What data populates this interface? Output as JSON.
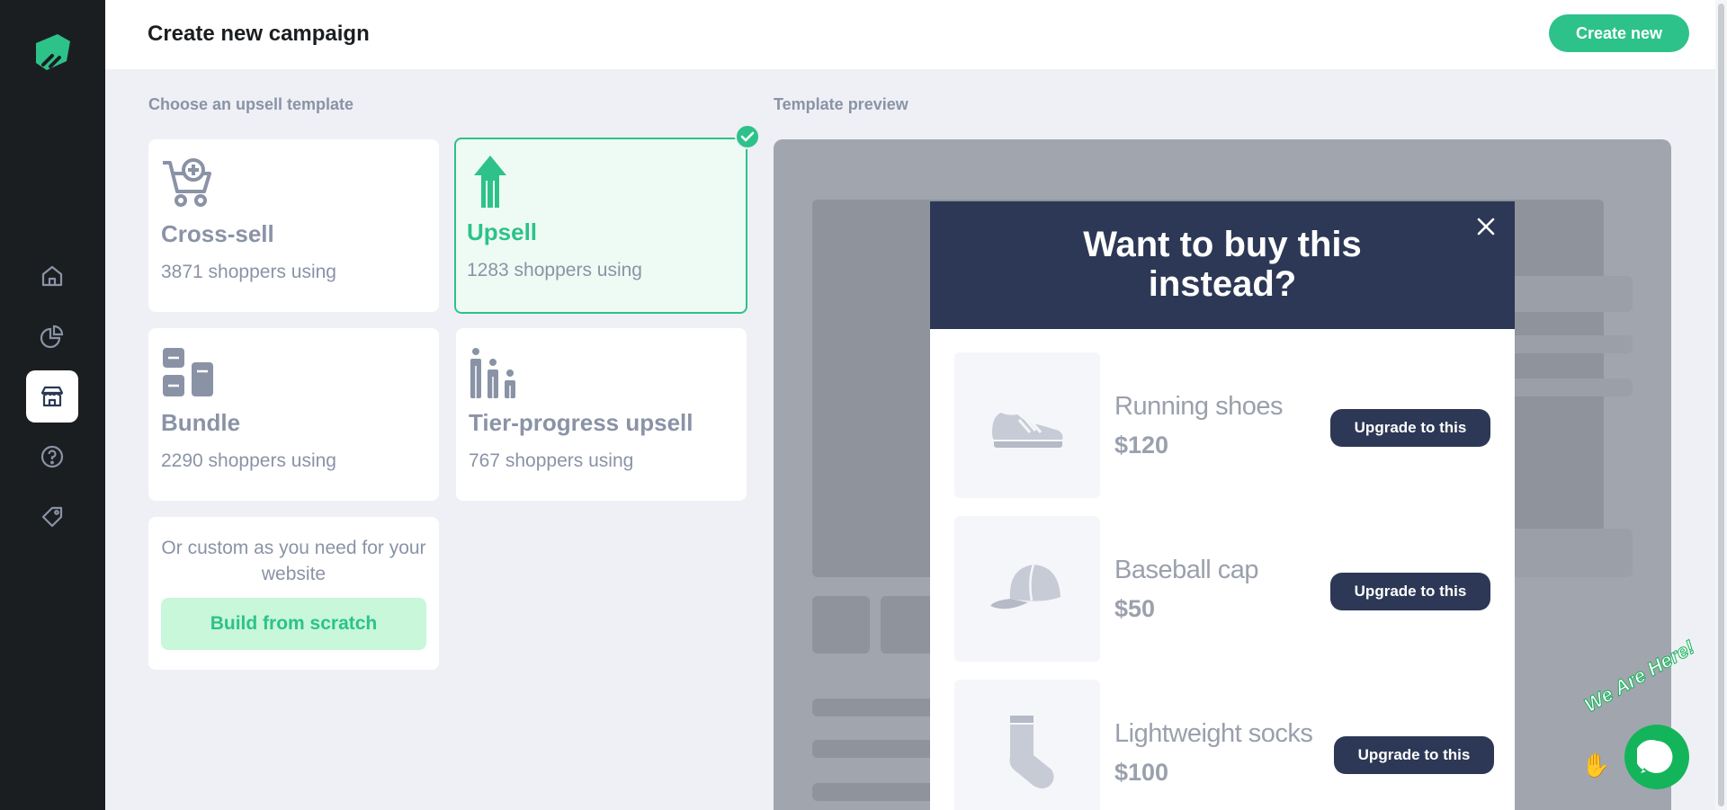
{
  "header": {
    "title": "Create new campaign",
    "create_button": "Create new"
  },
  "sidebar": {
    "items": [
      {
        "icon": "home-icon"
      },
      {
        "icon": "analytics-icon"
      },
      {
        "icon": "store-icon",
        "active": true
      },
      {
        "icon": "help-icon"
      },
      {
        "icon": "tag-icon"
      }
    ]
  },
  "templates": {
    "label": "Choose an upsell template",
    "cards": [
      {
        "name": "Cross-sell",
        "usage": "3871 shoppers using"
      },
      {
        "name": "Upsell",
        "usage": "1283 shoppers using",
        "selected": true
      },
      {
        "name": "Bundle",
        "usage": "2290 shoppers using"
      },
      {
        "name": "Tier-progress upsell",
        "usage": "767 shoppers using"
      }
    ],
    "custom_text": "Or custom as you need for your website",
    "scratch_button": "Build from scratch"
  },
  "preview": {
    "label": "Template preview",
    "modal_title": "Want to buy this instead?",
    "products": [
      {
        "name": "Running shoes",
        "price": "$120",
        "button": "Upgrade to this"
      },
      {
        "name": "Baseball cap",
        "price": "$50",
        "button": "Upgrade to this"
      },
      {
        "name": "Lightweight socks",
        "price": "$100",
        "button": "Upgrade to this"
      }
    ]
  },
  "chat": {
    "label": "We Are Here!"
  },
  "colors": {
    "accent": "#2dc28a",
    "sidebar": "#1b1e21",
    "modal_header": "#2c3855",
    "chat": "#14b55a"
  }
}
